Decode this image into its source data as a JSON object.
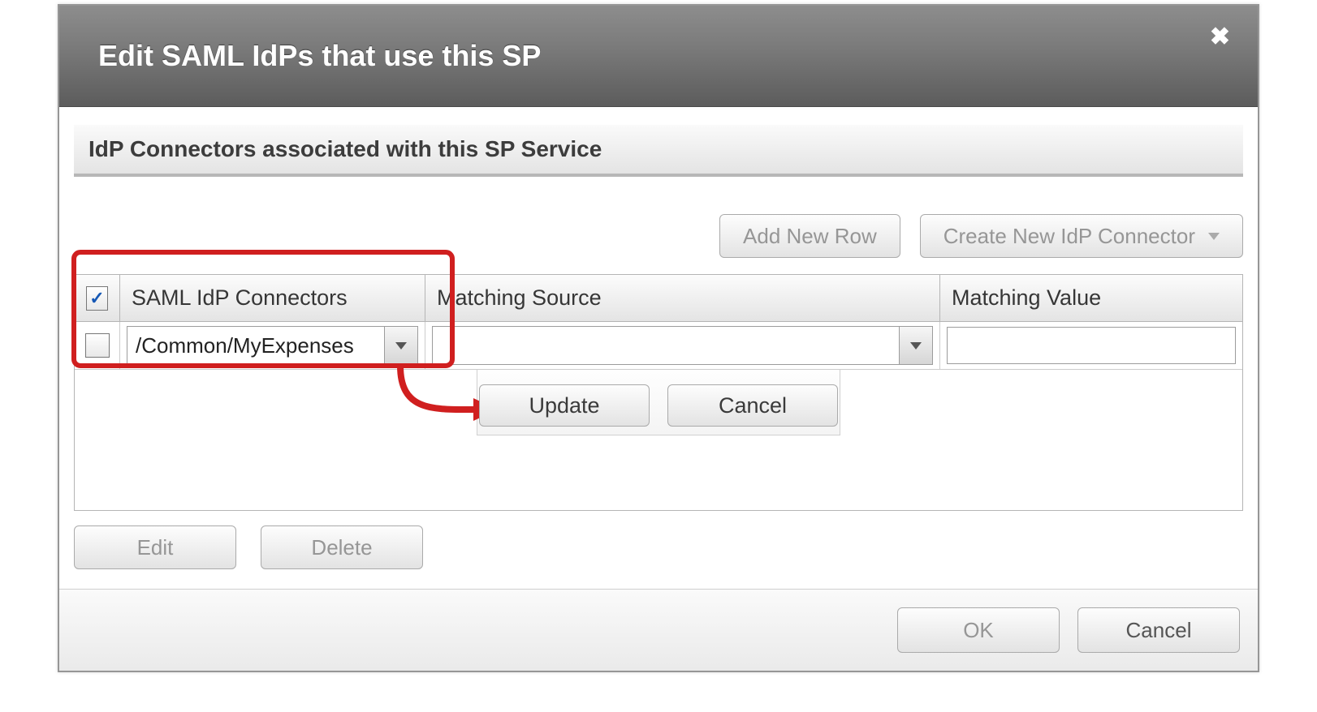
{
  "dialog": {
    "title": "Edit SAML IdPs that use this SP",
    "section_title": "IdP Connectors associated with this SP Service",
    "close_label": "✖"
  },
  "top_buttons": {
    "add_row": "Add New Row",
    "create_idp": "Create New IdP Connector"
  },
  "table": {
    "headers": {
      "col_connectors": "SAML IdP Connectors",
      "col_matching_source": "Matching Source",
      "col_matching_value": "Matching Value"
    },
    "row": {
      "connector_value": "/Common/MyExpenses",
      "matching_source_value": "",
      "matching_value_value": ""
    }
  },
  "inner_buttons": {
    "update": "Update",
    "cancel": "Cancel"
  },
  "grid_bottom": {
    "edit": "Edit",
    "delete": "Delete"
  },
  "footer": {
    "ok": "OK",
    "cancel": "Cancel"
  },
  "annotation": {
    "highlight_color": "#d01f1f"
  }
}
